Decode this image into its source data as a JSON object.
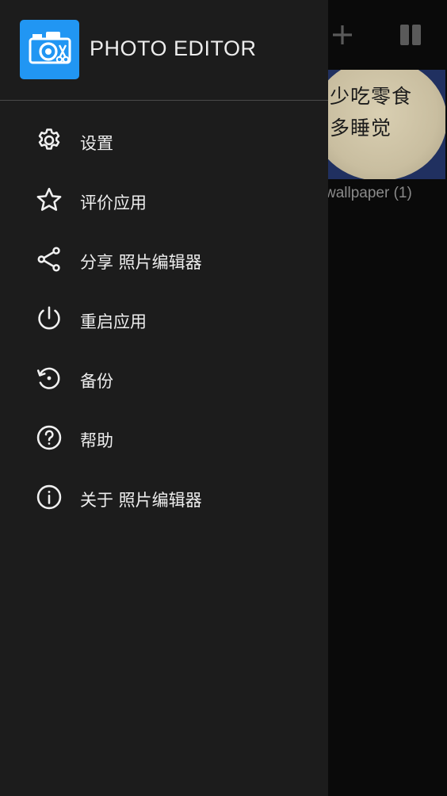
{
  "background": {
    "toolbar": {
      "add_icon": "plus-icon",
      "columns_icon": "columns-icon"
    },
    "thumbnail": {
      "image_text_lines": [
        "少吃零食",
        "多睡觉"
      ],
      "caption": "wallpaper (1)"
    }
  },
  "drawer": {
    "app_title": "PHOTO EDITOR",
    "logo_icon": "camera-scissors-icon",
    "accent_color": "#2196f3",
    "items": [
      {
        "label": "设置",
        "icon": "gear-icon"
      },
      {
        "label": "评价应用",
        "icon": "star-icon"
      },
      {
        "label": "分享 照片编辑器",
        "icon": "share-icon"
      },
      {
        "label": "重启应用",
        "icon": "power-icon"
      },
      {
        "label": "备份",
        "icon": "backup-restore-icon"
      },
      {
        "label": "帮助",
        "icon": "help-icon"
      },
      {
        "label": "关于 照片编辑器",
        "icon": "info-icon"
      }
    ]
  }
}
